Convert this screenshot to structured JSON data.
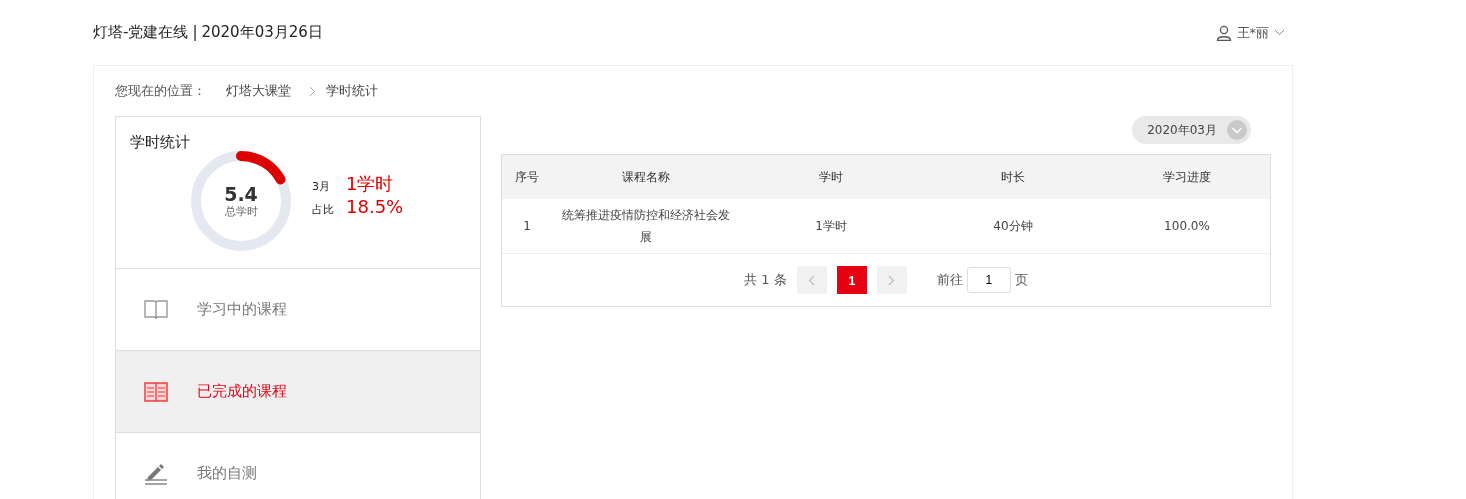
{
  "header": {
    "site": "灯塔-党建在线",
    "separator": "|",
    "date": "2020年03月26日",
    "user": "王*丽"
  },
  "breadcrumb": {
    "label": "您现在的位置：",
    "items": [
      "灯塔大课堂",
      "学时统计"
    ]
  },
  "stats": {
    "title": "学时统计",
    "total": "5.4",
    "total_label": "总学时",
    "month_label": "3月",
    "month_value": "1学时",
    "ratio_label": "占比",
    "ratio_value": "18.5%"
  },
  "menu": [
    {
      "label": "学习中的课程",
      "kind": "book",
      "selected": false
    },
    {
      "label": "已完成的课程",
      "kind": "book",
      "selected": true
    },
    {
      "label": "我的自测",
      "kind": "pen",
      "selected": false
    }
  ],
  "month_select": {
    "value": "2020年03月"
  },
  "table": {
    "columns": [
      "序号",
      "课程名称",
      "学时",
      "时长",
      "学习进度"
    ],
    "rows": [
      [
        "1",
        "统筹推进疫情防控和经济社会发展",
        "1学时",
        "40分钟",
        "100.0%"
      ]
    ]
  },
  "pagination": {
    "total": "共 1 条",
    "pages": [
      {
        "label": "1",
        "selected": true
      }
    ],
    "goto_label": "前往",
    "goto_value": "1",
    "goto_unit": "页"
  }
}
